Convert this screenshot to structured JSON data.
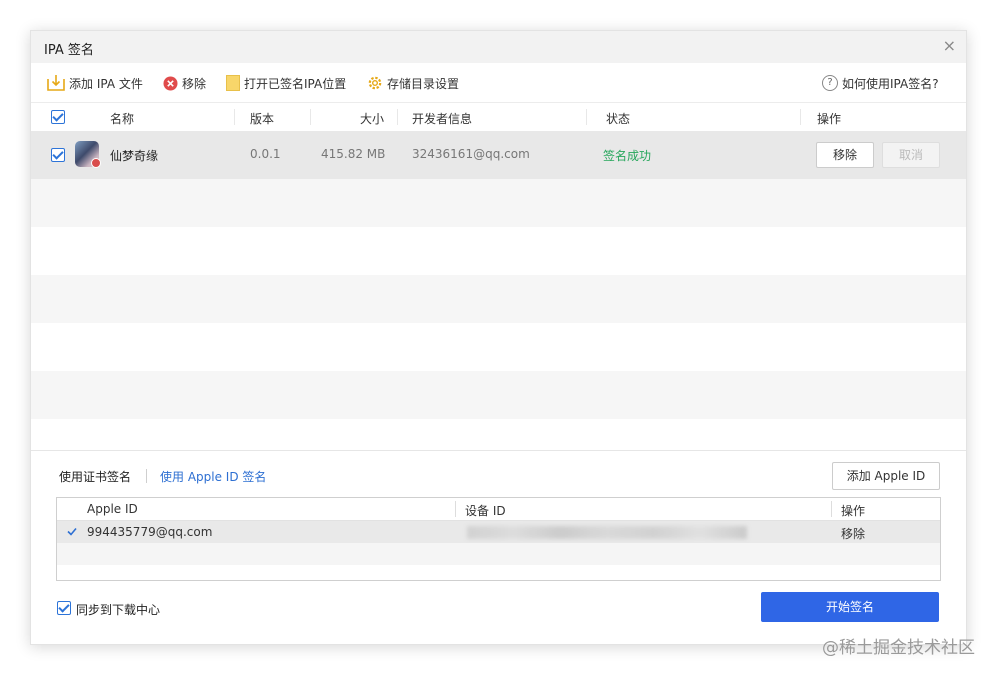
{
  "window": {
    "title": "IPA 签名",
    "close_glyph": "×"
  },
  "toolbar": {
    "add_ipa": "添加 IPA 文件",
    "remove": "移除",
    "open_signed": "打开已签名IPA位置",
    "storage_settings": "存储目录设置",
    "help": "如何使用IPA签名?"
  },
  "table": {
    "headers": {
      "name": "名称",
      "version": "版本",
      "size": "大小",
      "developer": "开发者信息",
      "status": "状态",
      "actions": "操作"
    },
    "rows": [
      {
        "checked": true,
        "name": "仙梦奇缘",
        "version": "0.0.1",
        "size": "415.82 MB",
        "developer": "32436161@qq.com",
        "status": "签名成功",
        "remove_label": "移除",
        "cancel_label": "取消"
      }
    ]
  },
  "signing": {
    "tabs": [
      "使用证书签名",
      "使用 Apple ID 签名"
    ],
    "add_apple_id": "添加 Apple ID",
    "apple_table": {
      "headers": {
        "apple_id": "Apple ID",
        "device_id": "设备 ID",
        "actions": "操作"
      },
      "rows": [
        {
          "apple_id": "994435779@qq.com",
          "remove_label": "移除"
        }
      ]
    },
    "sync_label": "同步到下载中心",
    "start_button": "开始签名"
  },
  "watermark": "@稀土掘金技术社区",
  "colors": {
    "primary": "#2f66e6",
    "success": "#26a65b",
    "link": "#2d6fd2"
  }
}
